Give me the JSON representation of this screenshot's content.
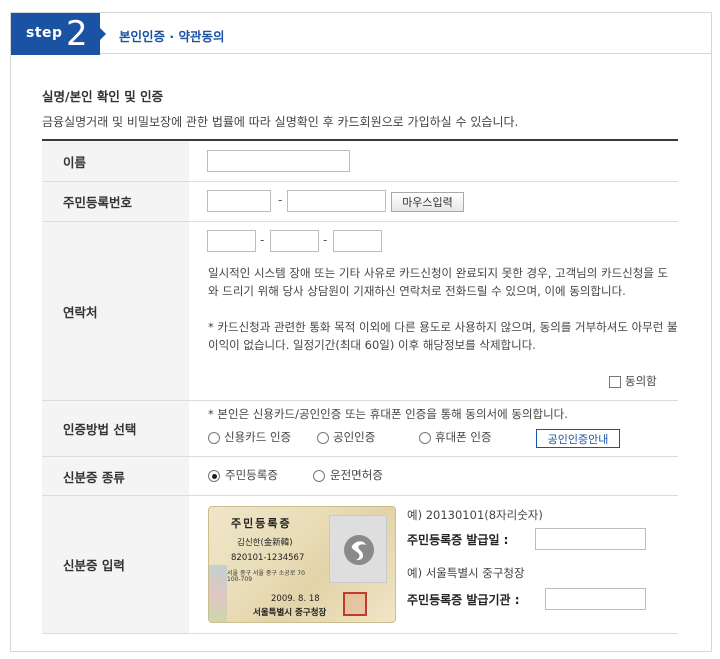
{
  "header": {
    "step_word": "step",
    "step_number": "2",
    "title": "본인인증 · 약관동의"
  },
  "section": {
    "title": "실명/본인 확인 및 인증",
    "description": "금융실명거래 및 비밀보장에 관한 법률에 따라 실명확인 후 카드회원으로 가입하실 수 있습니다."
  },
  "rows": {
    "name": {
      "label": "이름"
    },
    "rrn": {
      "label": "주민등록번호",
      "dash": "-",
      "mouse_button": "마우스입력"
    },
    "contact": {
      "label": "연락처",
      "dash1": "-",
      "dash2": "-",
      "notice1": "일시적인 시스템 장애 또는 기타 사유로 카드신청이 완료되지 못한 경우, 고객님의 카드신청을 도와 드리기 위해 당사 상담원이 기재하신 연락처로 전화드릴 수 있으며, 이에 동의합니다.",
      "notice2": "* 카드신청과 관련한 통화 목적 이외에 다른 용도로 사용하지 않으며, 동의를 거부하셔도 아무런 불이익이 없습니다. 일정기간(최대 60일) 이후 해당정보를 삭제합니다.",
      "agree_label": "동의함"
    },
    "auth": {
      "label": "인증방법 선택",
      "notice": "* 본인은 신용카드/공인인증 또는 휴대폰 인증을 통해 동의서에 동의합니다.",
      "options": [
        "신용카드 인증",
        "공인인증",
        "휴대폰 인증"
      ],
      "guide_button": "공인인증안내"
    },
    "id_type": {
      "label": "신분증 종류",
      "options": [
        "주민등록증",
        "운전면허증"
      ],
      "selected": "주민등록증"
    },
    "id_input": {
      "label": "신분증 입력",
      "card": {
        "title": "주민등록증",
        "name": "김신한(金新韓)",
        "number": "820101-1234567",
        "address1": "서울 중구 서울 중구 소공로 70",
        "address2": "100-709",
        "date": "2009. 8. 18",
        "issuer": "서울특별시 중구청장"
      },
      "example1": "예) 20130101(8자리숫자)",
      "field1_label": "주민등록증 발급일 :",
      "example2": "예) 서울특별시 중구청장",
      "field2_label": "주민등록증 발급기관 :"
    }
  }
}
